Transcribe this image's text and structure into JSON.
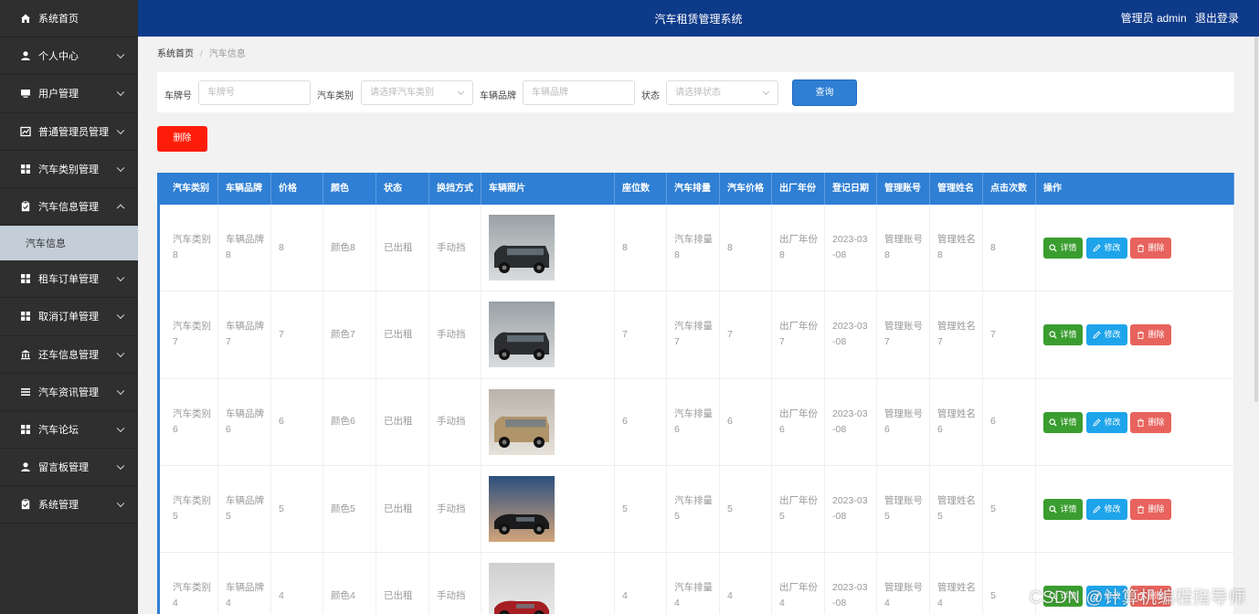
{
  "app": {
    "title": "汽车租赁管理系统"
  },
  "topbar": {
    "user_label": "管理员 admin",
    "logout_label": "退出登录"
  },
  "sidebar": {
    "items": [
      {
        "label": "系统首页",
        "icon": "home-icon",
        "chevron": false
      },
      {
        "label": "个人中心",
        "icon": "user-icon",
        "chevron": true
      },
      {
        "label": "用户管理",
        "icon": "monitor-icon",
        "chevron": true
      },
      {
        "label": "普通管理员管理",
        "icon": "chart-icon",
        "chevron": true
      },
      {
        "label": "汽车类别管理",
        "icon": "grid-icon",
        "chevron": true
      },
      {
        "label": "汽车信息管理",
        "icon": "clipboard-icon",
        "chevron": true,
        "expanded": true
      },
      {
        "label": "租车订单管理",
        "icon": "grid-icon",
        "chevron": true
      },
      {
        "label": "取消订单管理",
        "icon": "grid-icon",
        "chevron": true
      },
      {
        "label": "还车信息管理",
        "icon": "bank-icon",
        "chevron": true
      },
      {
        "label": "汽车资讯管理",
        "icon": "list-icon",
        "chevron": true
      },
      {
        "label": "汽车论坛",
        "icon": "grid-icon",
        "chevron": true
      },
      {
        "label": "留言板管理",
        "icon": "user-icon",
        "chevron": true
      },
      {
        "label": "系统管理",
        "icon": "clipboard-icon",
        "chevron": true
      }
    ],
    "sub_item": "汽车信息"
  },
  "breadcrumb": {
    "home": "系统首页",
    "sep": "/",
    "current": "汽车信息"
  },
  "search": {
    "plate_label": "车牌号",
    "plate_placeholder": "车牌号",
    "type_label": "汽车类别",
    "type_placeholder": "请选择汽车类别",
    "brand_label": "车辆品牌",
    "brand_placeholder": "车辆品牌",
    "status_label": "状态",
    "status_placeholder": "请选择状态",
    "query_button": "查询"
  },
  "delete_button": "删除",
  "table": {
    "headers": [
      "汽车类别",
      "车辆品牌",
      "价格",
      "颜色",
      "状态",
      "换挡方式",
      "车辆照片",
      "座位数",
      "汽车排量",
      "汽车价格",
      "出厂年份",
      "登记日期",
      "管理账号",
      "管理姓名",
      "点击次数",
      "操作"
    ],
    "actions": {
      "detail": "详情",
      "edit": "修改",
      "remove": "删除"
    },
    "rows": [
      {
        "type": "汽车类别\n8",
        "brand": "车辆品牌\n8",
        "price": "8",
        "color": "颜色8",
        "status": "已出租",
        "gear": "手动挡",
        "photo": "dark-suv",
        "seats": "8",
        "displacement": "汽车排量\n8",
        "car_price": "8",
        "year": "出厂年份\n8",
        "date": "2023-03\n-08",
        "account": "管理账号\n8",
        "name": "管理姓名\n8",
        "clicks": "8"
      },
      {
        "type": "汽车类别\n7",
        "brand": "车辆品牌\n7",
        "price": "7",
        "color": "颜色7",
        "status": "已出租",
        "gear": "手动挡",
        "photo": "dark-suv",
        "seats": "7",
        "displacement": "汽车排量\n7",
        "car_price": "7",
        "year": "出厂年份\n7",
        "date": "2023-03\n-08",
        "account": "管理账号\n7",
        "name": "管理姓名\n7",
        "clicks": "7"
      },
      {
        "type": "汽车类别\n6",
        "brand": "车辆品牌\n6",
        "price": "6",
        "color": "颜色6",
        "status": "已出租",
        "gear": "手动挡",
        "photo": "gold-suv",
        "seats": "6",
        "displacement": "汽车排量\n6",
        "car_price": "6",
        "year": "出厂年份\n6",
        "date": "2023-03\n-08",
        "account": "管理账号\n6",
        "name": "管理姓名\n6",
        "clicks": "6"
      },
      {
        "type": "汽车类别\n5",
        "brand": "车辆品牌\n5",
        "price": "5",
        "color": "颜色5",
        "status": "已出租",
        "gear": "手动挡",
        "photo": "black-sedan",
        "seats": "5",
        "displacement": "汽车排量\n5",
        "car_price": "5",
        "year": "出厂年份\n5",
        "date": "2023-03\n-08",
        "account": "管理账号\n5",
        "name": "管理姓名\n5",
        "clicks": "5"
      },
      {
        "type": "汽车类别\n4",
        "brand": "车辆品牌\n4",
        "price": "4",
        "color": "颜色4",
        "status": "已出租",
        "gear": "手动挡",
        "photo": "red-sports",
        "seats": "4",
        "displacement": "汽车排量\n4",
        "car_price": "4",
        "year": "出厂年份\n4",
        "date": "2023-03\n-08",
        "account": "管理账号\n4",
        "name": "管理姓名\n4",
        "clicks": "5"
      }
    ]
  },
  "watermark": "CSDN @计算机编程指导师",
  "colors": {
    "sidebar": "#2f2f2f",
    "topbar": "#0e3a8a",
    "header": "#2f7fd4",
    "danger": "#ff1d0a",
    "detail": "#3a9d2f",
    "edit": "#1ea4ea",
    "remove": "#e8635d"
  }
}
